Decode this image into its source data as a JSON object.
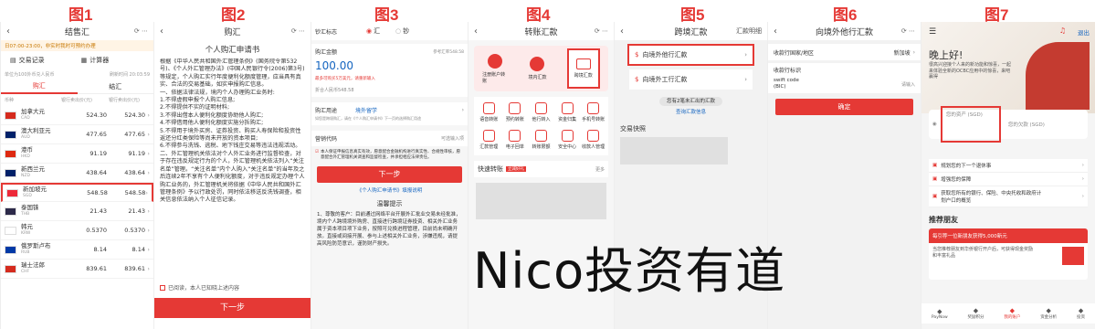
{
  "labels": [
    "图1",
    "图2",
    "图3",
    "图4",
    "图5",
    "图6",
    "图7"
  ],
  "watermark": "Nico投资有道",
  "p1": {
    "title": "结售汇",
    "notice": "日07:00-23:00，非实时我时可预约办理",
    "trade_record": "交易记录",
    "calculator": "计算器",
    "unit_note": "单位为100外币兑人民币",
    "refresh_time": "刷新时间 20:03:59",
    "tab_buy": "购汇",
    "tab_sell": "结汇",
    "col_currency": "币种",
    "col_buy": "银行卖出价(元)",
    "col_sell": "银行卖出价(元)",
    "rows": [
      {
        "name": "加拿大元",
        "code": "CAD",
        "buy": "524.30",
        "sell": "524.30"
      },
      {
        "name": "澳大利亚元",
        "code": "AUD",
        "buy": "477.65",
        "sell": "477.65"
      },
      {
        "name": "港币",
        "code": "HKD",
        "buy": "91.19",
        "sell": "91.19"
      },
      {
        "name": "新西兰元",
        "code": "NZD",
        "buy": "438.64",
        "sell": "438.64"
      },
      {
        "name": "新加坡元",
        "code": "SGD",
        "buy": "548.58",
        "sell": "548.58"
      },
      {
        "name": "泰国铢",
        "code": "THB",
        "buy": "21.43",
        "sell": "21.43"
      },
      {
        "name": "韩元",
        "code": "KRW",
        "buy": "0.5370",
        "sell": "0.5370"
      },
      {
        "name": "俄罗斯卢布",
        "code": "RUB",
        "buy": "8.14",
        "sell": "8.14"
      },
      {
        "name": "瑞士法郎",
        "code": "CHF",
        "buy": "839.61",
        "sell": "839.61"
      }
    ]
  },
  "p2": {
    "title": "购汇",
    "doc_title": "个人购汇申请书",
    "body": "根据《中华人民共和国外汇管理条例》(国务院令第532号)、《个人外汇管理办法》(中国人民银行令(2006)第3号)等规定，个人购汇实行年度便利化额度管理，应当具有真实、合法的交易基础，如实申报购汇信息。\n一、依据法律法规，境内个人办理购汇业务时:\n1.不得虚假申报个人购汇信息;\n2.不得提供不实的证明材料;\n3.不得出借本人便利化额度协助他人购汇;\n4.不得借用他人便利化额度实施分拆购汇;\n5.不得用于境外买房、证券投资、购买人寿保险和投资性返还分红类保险等尚未开放的资本项目;\n6.不得参与洗钱、逃税、地下钱庄交易等违法违规活动。\n二、外汇管理机关依法对个人外汇业务进行监督检查，对于存在违反规定行为的个人，外汇管理机关依法列入“关注名单”管理。“关注名单”内个人购入“关注名单”的当年及之后连续2年不享有个人便利化额度，对于违反规定办理个人购汇业务的，外汇管理机关将依据《中华人民共和国外汇管理条例》予以行政处罚，同时依法移送反洗钱调查，相关信息依法纳入个人征信记录。",
    "agree": "已阅读，本人已知晓上述内容",
    "next": "下一步"
  },
  "p3": {
    "label_type": "钞汇标志",
    "opt_hui": "汇",
    "opt_chao": "钞",
    "label_amount": "购汇金额",
    "rate_note": "参考汇率548.58",
    "amount": "100.00",
    "cap_note": "最多可购买5万美元，请重新输入",
    "equiv": "折合人民币548.58",
    "label_purpose": "购汇用途",
    "purpose": "境外留学",
    "purpose_note": "如您是跨境购汇，请在《个人购汇申请书》下一页的选择购汇用途",
    "label_code": "营销代码",
    "code_ph": "可选输入项",
    "consent": "本人保证申报信息真实有效，愿意配合金融机构进行真实性、合规性审核，愿意配合外汇管理机关调查和监督检查，并承担相应法律责任。",
    "next": "下一步",
    "link": "《个人购汇申请书》填报说明",
    "tips_title": "温馨提示",
    "tips": "1、尊敬的客户：目前通过网络平台开展外汇批业交易未经批准，境内个人跨境境外购房、直接进行跨境证券投资、相关外汇业务属于资本项目项下业务，按照可兑换进程管理，目前尚未明确开放。直接或间接开展、参与上述相关外汇业务，涉嫌违规，请提高风险防范意识，谨防财产损失。"
  },
  "p4": {
    "title": "转账汇款",
    "top": [
      "注册账户转账",
      "境内汇款",
      "跨境汇款"
    ],
    "grid": [
      "语音转账",
      "预约转账",
      "他行转入",
      "资金归集",
      "手机号转账",
      "汇款管理",
      "电子回单",
      "转账限额",
      "安全中心",
      "收款人管理"
    ],
    "quick": "快速转账",
    "quick_badge": "立减好礼",
    "more": "更多"
  },
  "p5": {
    "title": "跨境汇款",
    "detail": "汇款明细",
    "opt1": "向境外他行汇款",
    "opt2": "向境外工行汇款",
    "pending": "您有2笔未汇出的汇款",
    "query": "查询汇款信息",
    "quick": "交易快照"
  },
  "p6": {
    "title": "向境外他行汇款",
    "country_label": "收款行国家/地区",
    "country_val": "新加坡",
    "bank_label": "收款行标识",
    "swift": "swift code\n(BIC)",
    "swift_ph": "请输入",
    "confirm": "确定"
  },
  "p7": {
    "exit": "退出",
    "greet": "晚上好!",
    "welcome": "很高兴迎接个人来的新功能和惊喜，一起来体验全新的OCBC应用中的惊喜，来吧赢得",
    "tab_assets": "您的资产 (SGD)",
    "tab_debt": "您的欠款 (SGD)",
    "items": [
      "规划您的下一个退休事",
      "增强您的保障",
      "获取您所有的银行、保险、中央托收和政府计划户口的概览"
    ],
    "rec": "推荐朋友",
    "rec_title": "每引荐一位新朋友获得5,000新元",
    "rec_body": "当您推荐朋友到华侨银行开户后，可获得现金奖励和丰富礼品",
    "nav": [
      "PayNow",
      "奖励积分",
      "我的账户",
      "资金分析",
      "投资"
    ]
  }
}
